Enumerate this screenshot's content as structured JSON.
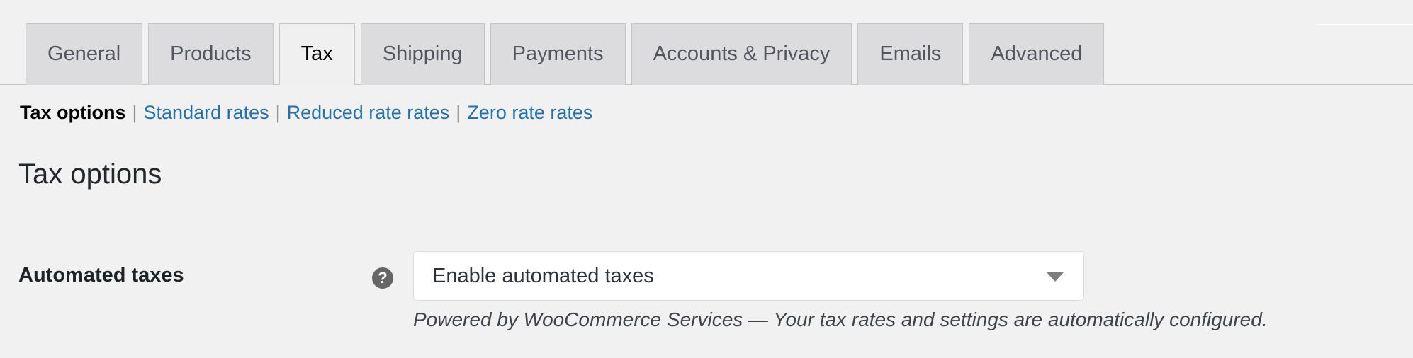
{
  "tabs": [
    {
      "label": "General",
      "active": false
    },
    {
      "label": "Products",
      "active": false
    },
    {
      "label": "Tax",
      "active": true
    },
    {
      "label": "Shipping",
      "active": false
    },
    {
      "label": "Payments",
      "active": false
    },
    {
      "label": "Accounts & Privacy",
      "active": false
    },
    {
      "label": "Emails",
      "active": false
    },
    {
      "label": "Advanced",
      "active": false
    }
  ],
  "subnav": {
    "items": [
      {
        "label": "Tax options",
        "current": true
      },
      {
        "label": "Standard rates",
        "current": false
      },
      {
        "label": "Reduced rate rates",
        "current": false
      },
      {
        "label": "Zero rate rates",
        "current": false
      }
    ],
    "separator": "|"
  },
  "heading": "Tax options",
  "form": {
    "rows": [
      {
        "label": "Automated taxes",
        "help_icon": "help-question-icon",
        "help_glyph": "?",
        "select_value": "Enable automated taxes",
        "description": "Powered by WooCommerce Services — Your tax rates and settings are automatically configured."
      }
    ]
  },
  "colors": {
    "page_background": "#f1f1f1",
    "link": "#2271b1",
    "tab_inactive_background": "#dcdcde",
    "tab_active_background": "#f0f0f1",
    "border": "#c3c4c7",
    "help_icon_background": "#666666"
  }
}
